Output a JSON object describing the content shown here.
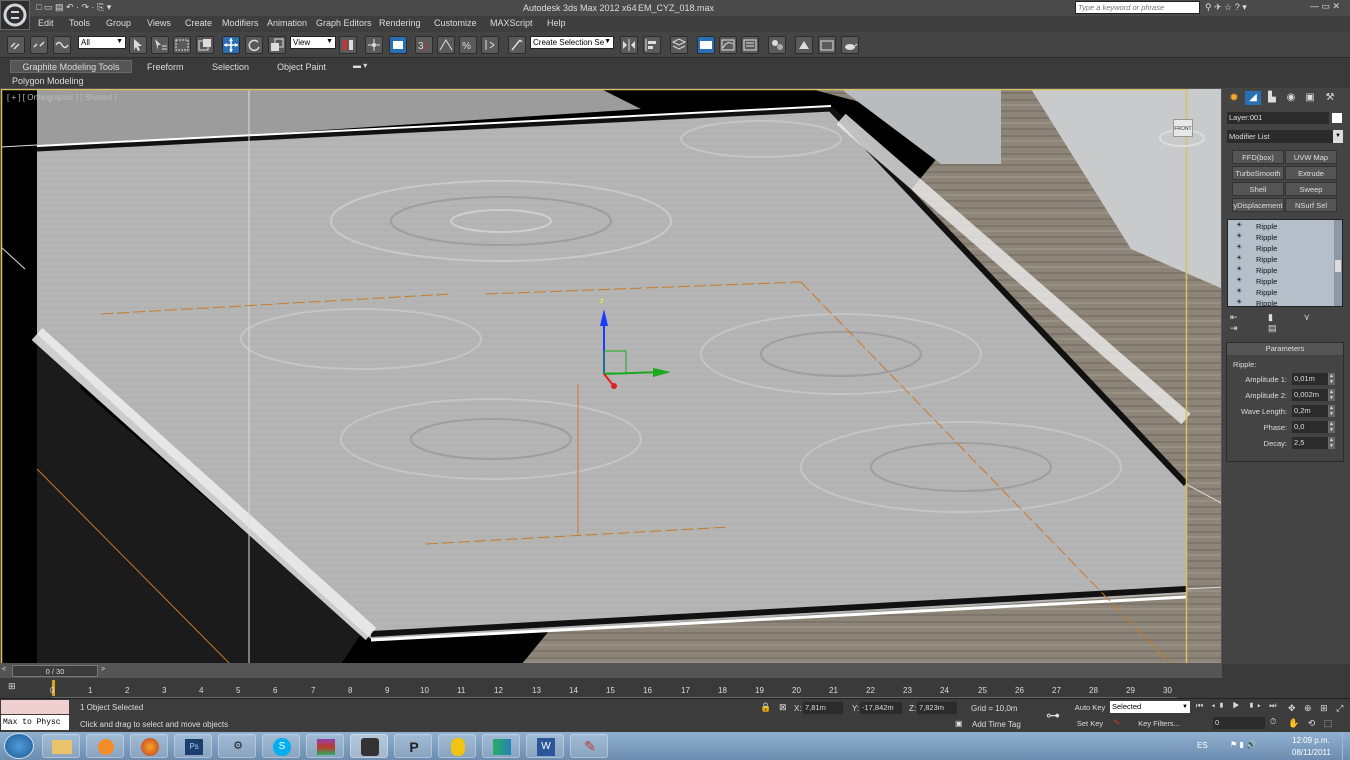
{
  "window": {
    "title": "Autodesk 3ds Max  2012 x64",
    "filename": "EM_CYZ_018.max",
    "search_placeholder": "Type a keyword or phrase"
  },
  "menu": [
    "Edit",
    "Tools",
    "Group",
    "Views",
    "Create",
    "Modifiers",
    "Animation",
    "Graph Editors",
    "Rendering",
    "Customize",
    "MAXScript",
    "Help"
  ],
  "toolbar": {
    "filter_value": "All",
    "refcoord_value": "View",
    "selection_set_placeholder": "Create Selection Se"
  },
  "ribbon": {
    "tabs": [
      "Graphite Modeling Tools",
      "Freeform",
      "Selection",
      "Object Paint"
    ],
    "active_tab": "Graphite Modeling Tools",
    "subtab": "Polygon Modeling"
  },
  "viewport": {
    "label": "[ + ] [ Orthographic ] [ Shaded ]",
    "viewcube": "FRONT"
  },
  "command_panel": {
    "object_name": "Layer:001",
    "modifier_list": "Modifier List",
    "buttons": [
      "FFD(box)",
      "UVW Map",
      "TurboSmooth",
      "Extrude",
      "Shell",
      "Sweep",
      "yDisplacement",
      "NSurf Sel"
    ],
    "stack": [
      "Ripple",
      "Ripple",
      "Ripple",
      "Ripple",
      "Ripple",
      "Ripple",
      "Ripple",
      "Ripple"
    ],
    "rollout_title": "Parameters",
    "group_label": "Ripple:",
    "params": [
      {
        "label": "Amplitude 1:",
        "value": "0,01m"
      },
      {
        "label": "Amplitude 2:",
        "value": "0,002m"
      },
      {
        "label": "Wave Length:",
        "value": "0,2m"
      },
      {
        "label": "Phase:",
        "value": "0,0"
      },
      {
        "label": "Decay:",
        "value": "2,5"
      }
    ]
  },
  "timeline": {
    "frame": "0 / 30",
    "ticks": [
      "0",
      "1",
      "2",
      "3",
      "4",
      "5",
      "6",
      "7",
      "8",
      "9",
      "10",
      "11",
      "12",
      "13",
      "14",
      "15",
      "16",
      "17",
      "18",
      "19",
      "20",
      "21",
      "22",
      "23",
      "24",
      "25",
      "26",
      "27",
      "28",
      "29",
      "30"
    ]
  },
  "status": {
    "script_text": "Max to Physc",
    "selected_text": "1 Object Selected",
    "prompt": "Click and drag to select and move objects",
    "x": "7,81m",
    "y": "-17,842m",
    "z": "7,823m",
    "grid": "Grid = 10,0m",
    "add_time_tag": "Add Time Tag",
    "auto_key": "Auto Key",
    "set_key": "Set Key",
    "key_mode": "Selected",
    "key_filters": "Key Filters...",
    "current_frame": "0"
  },
  "taskbar": {
    "lang": "ES",
    "time": "12:09 p.m.",
    "date": "08/11/2011"
  },
  "colors": {
    "accent": "#2a6fb3",
    "viewport_border": "#d9c060"
  }
}
